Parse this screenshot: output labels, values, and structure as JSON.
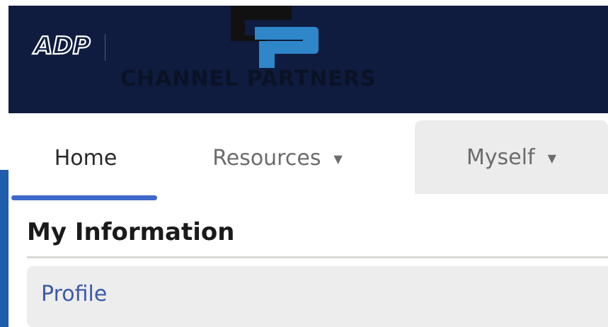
{
  "header": {
    "brand_logo": "ADP",
    "partner_wordmark": "CHANNEL PARTNERS",
    "colors": {
      "banner": "#0f1c3f",
      "mark_blue": "#2f86c8",
      "mark_dark": "#111111"
    }
  },
  "nav": {
    "tabs": [
      {
        "label": "Home",
        "active": true
      },
      {
        "label": "Resources",
        "has_dropdown": true,
        "icon": "caret-down-icon"
      },
      {
        "label": "Myself",
        "has_dropdown": true,
        "icon": "caret-down-icon",
        "highlighted": true
      }
    ],
    "active_indicator_color": "#3e68c9"
  },
  "content": {
    "section_title": "My Information",
    "items": [
      {
        "label": "Profile"
      }
    ],
    "link_color": "#3c5aa6"
  },
  "caret_glyph": "▼"
}
